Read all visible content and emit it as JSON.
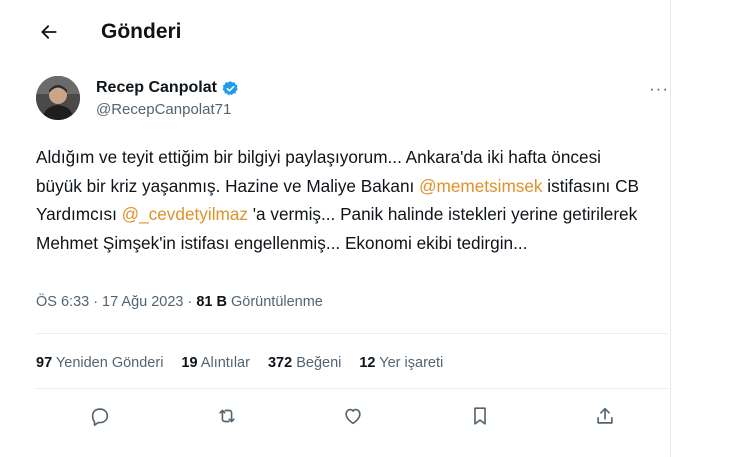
{
  "header": {
    "title": "Gönderi",
    "back_icon": "arrow-left-icon"
  },
  "author": {
    "name": "Recep Canpolat",
    "handle": "@RecepCanpolat71",
    "verified_icon": "verified-badge-icon",
    "verified_color": "#1d9bf0"
  },
  "more_icon": "more-horizontal-icon",
  "more_label": "···",
  "tweet": {
    "segments": [
      {
        "text": "Aldığım ve teyit ettiğim bir bilgiyi paylaşıyorum... Ankara'da iki hafta öncesi büyük bir kriz yaşanmış. Hazine ve Maliye Bakanı "
      },
      {
        "text": "@memetsimsek",
        "mention": true
      },
      {
        "text": " istifasını CB Yardımcısı "
      },
      {
        "text": "@_cevdetyilmaz",
        "mention": true
      },
      {
        "text": " 'a vermiş... Panik halinde istekleri yerine getirilerek Mehmet Şimşek'in istifası engellenmiş... Ekonomi ekibi tedirgin..."
      }
    ],
    "mention_color": "#e0912b"
  },
  "meta": {
    "time": "ÖS 6:33",
    "sep1": "·",
    "date": "17 Ağu 2023",
    "sep2": "·",
    "views_count": "81 B",
    "views_label": "Görüntülenme"
  },
  "stats": [
    {
      "count": "97",
      "label": "Yeniden Gönderi"
    },
    {
      "count": "19",
      "label": "Alıntılar"
    },
    {
      "count": "372",
      "label": "Beğeni"
    },
    {
      "count": "12",
      "label": "Yer işareti"
    }
  ],
  "actions": [
    {
      "icon": "reply-icon"
    },
    {
      "icon": "retweet-icon"
    },
    {
      "icon": "like-icon"
    },
    {
      "icon": "bookmark-icon"
    },
    {
      "icon": "share-icon"
    }
  ]
}
